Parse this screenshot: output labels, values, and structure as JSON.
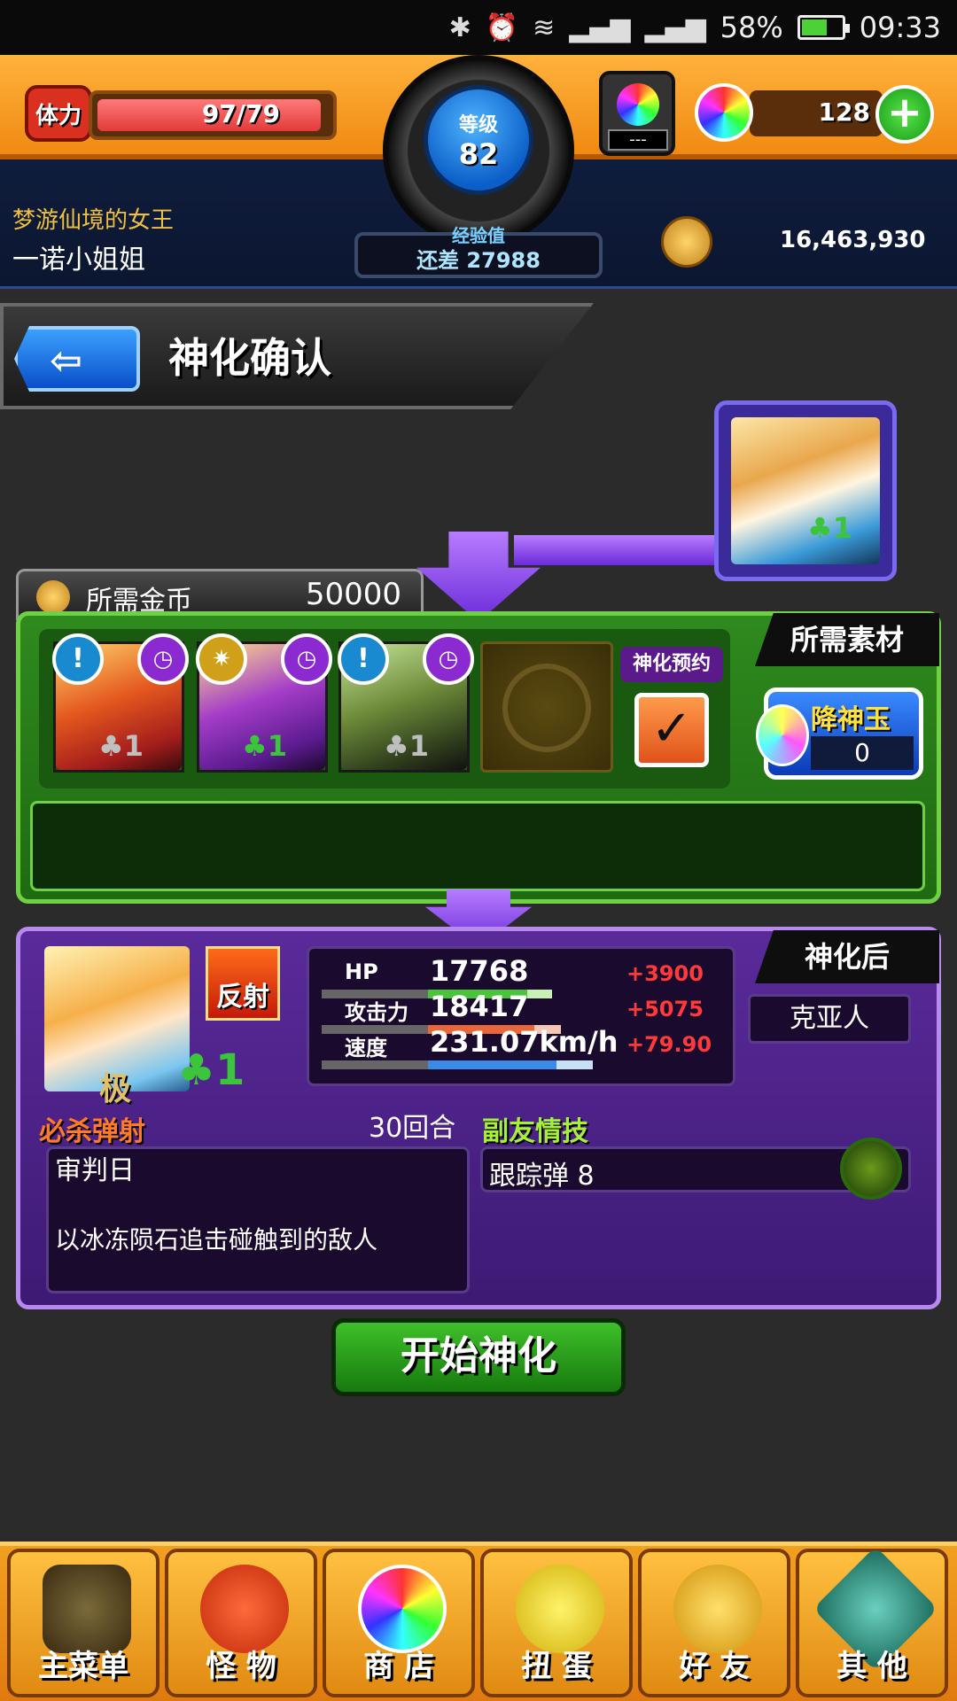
{
  "status_bar": {
    "battery": "58%",
    "time": "09:33",
    "battery_level": 0.58
  },
  "header": {
    "stamina_label": "体力",
    "stamina_value": "97/79",
    "level_label": "等级",
    "level_value": "82",
    "exp_label": "经验值",
    "exp_remaining": "还差 27988",
    "gacha_count": "---",
    "orb_count": "128",
    "user_title": "梦游仙境的女王",
    "user_name": "一诺小姐姐",
    "coins": "16,463,930"
  },
  "page": {
    "title": "神化确认"
  },
  "requirement": {
    "coin_label": "所需金币",
    "coin_value": "50000"
  },
  "materials": {
    "tag": "所需素材",
    "reserve_label": "神化预约",
    "reserve_checked": true,
    "slots": [
      {
        "clover": "1"
      },
      {
        "clover": "1"
      },
      {
        "clover": "1"
      }
    ],
    "gem_label": "降神玉",
    "gem_value": "0",
    "source_clover": "1"
  },
  "result": {
    "tag": "神化后",
    "rank": "极",
    "clover": "1",
    "type_badge": "反射",
    "stats": [
      {
        "label": "HP",
        "value": "17768",
        "bonus": "+3900"
      },
      {
        "label": "攻击力",
        "value": "18417",
        "bonus": "+5075"
      },
      {
        "label": "速度",
        "value": "231.07km/h",
        "bonus": "+79.90"
      }
    ],
    "race": "克亚人",
    "skill_label": "必杀弹射",
    "skill_turns": "30回合",
    "skill_name": "审判日",
    "skill_desc": "以冰冻陨石追击碰触到的敌人",
    "friend_label": "副友情技",
    "friend_skill": "跟踪弹 8"
  },
  "start_button": "开始神化",
  "nav": [
    {
      "label": "主菜单"
    },
    {
      "label": "怪 物"
    },
    {
      "label": "商 店"
    },
    {
      "label": "扭 蛋"
    },
    {
      "label": "好 友"
    },
    {
      "label": "其 他"
    }
  ]
}
